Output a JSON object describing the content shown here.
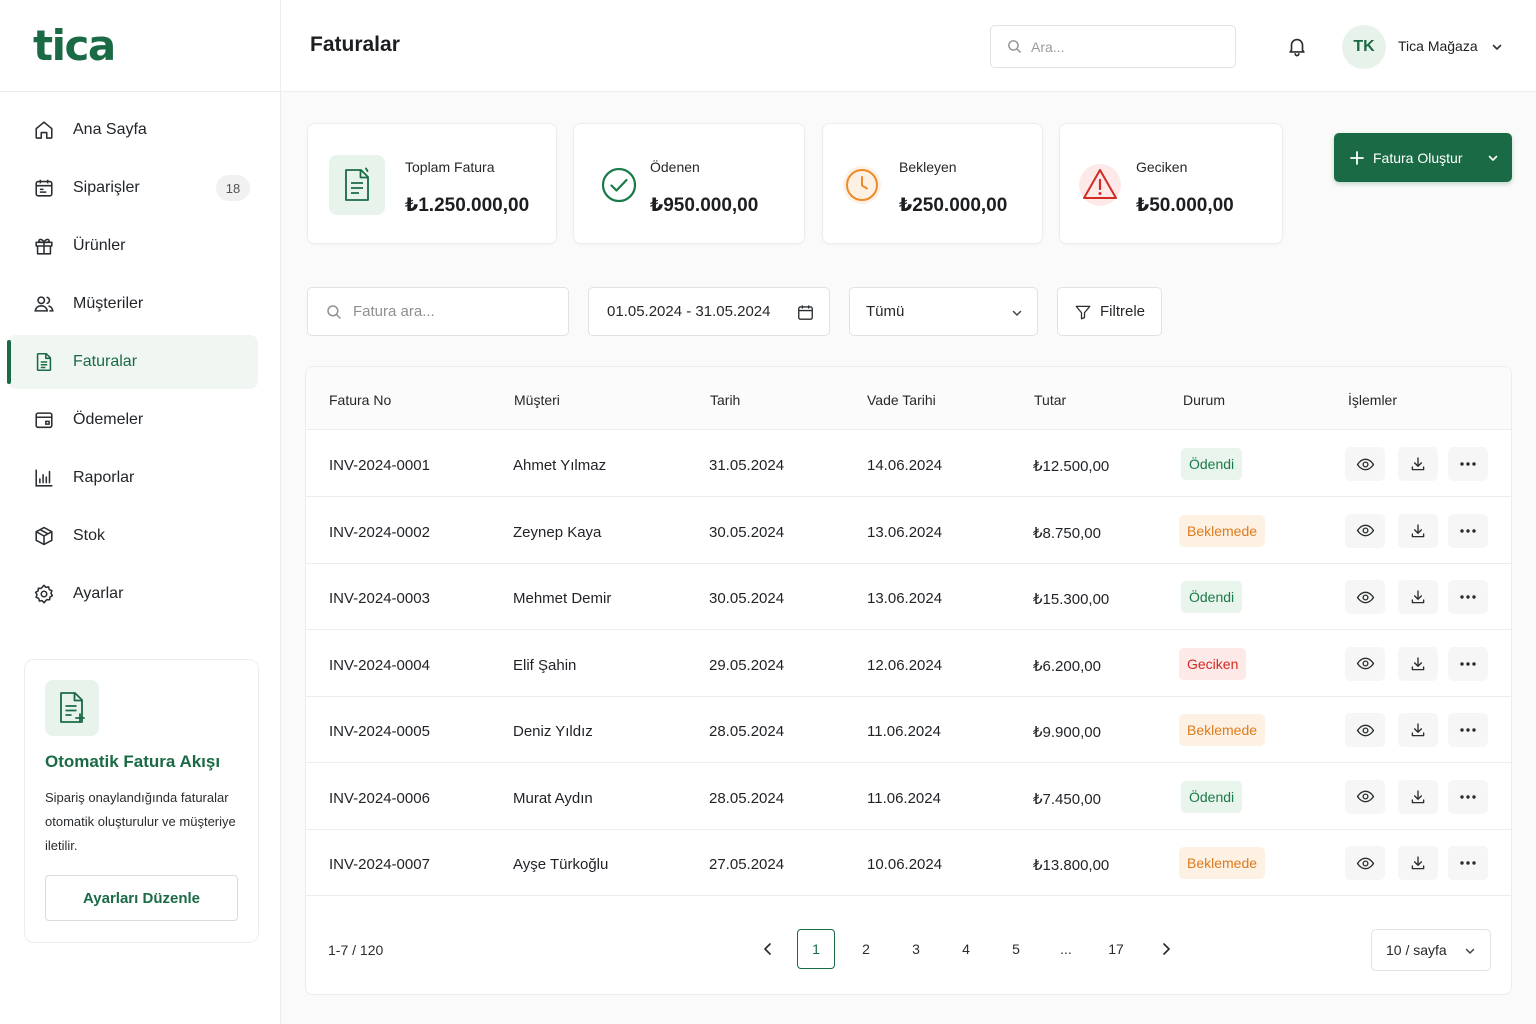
{
  "brand": {
    "logo": "tica",
    "accent": "#1a6b45"
  },
  "sidebar": {
    "items": [
      {
        "label": "Ana Sayfa",
        "icon": "home-icon"
      },
      {
        "label": "Siparişler",
        "icon": "orders-icon",
        "badge": "18"
      },
      {
        "label": "Ürünler",
        "icon": "gift-icon"
      },
      {
        "label": "Müşteriler",
        "icon": "users-icon"
      },
      {
        "label": "Faturalar",
        "icon": "document-icon",
        "active": true
      },
      {
        "label": "Ödemeler",
        "icon": "wallet-icon"
      },
      {
        "label": "Raporlar",
        "icon": "chart-icon"
      },
      {
        "label": "Stok",
        "icon": "box-icon"
      },
      {
        "label": "Ayarlar",
        "icon": "gear-icon"
      }
    ],
    "promo": {
      "title": "Otomatik Fatura Akışı",
      "text": "Sipariş onaylandığında faturalar otomatik oluşturulur ve müşteriye iletilir.",
      "button": "Ayarları Düzenle"
    }
  },
  "header": {
    "title": "Faturalar",
    "search_placeholder": "Ara...",
    "user_initials": "TK",
    "user_name": "Tica Mağaza"
  },
  "stats": [
    {
      "label": "Toplam Fatura",
      "value": "₺1.250.000,00",
      "icon": "invoice-icon"
    },
    {
      "label": "Ödenen",
      "value": "₺950.000,00",
      "icon": "check-circle-icon"
    },
    {
      "label": "Bekleyen",
      "value": "₺250.000,00",
      "icon": "clock-icon"
    },
    {
      "label": "Geciken",
      "value": "₺50.000,00",
      "icon": "warning-icon"
    }
  ],
  "create_button": "Fatura Oluştur",
  "filters": {
    "search_placeholder": "Fatura ara...",
    "date_range": "01.05.2024 - 31.05.2024",
    "status_select": "Tümü",
    "filter_button": "Filtrele"
  },
  "table": {
    "columns": [
      "Fatura No",
      "Müşteri",
      "Tarih",
      "Vade Tarihi",
      "Tutar",
      "Durum",
      "İşlemler"
    ],
    "rows": [
      {
        "no": "INV-2024-0001",
        "customer": "Ahmet Yılmaz",
        "date": "31.05.2024",
        "due": "14.06.2024",
        "amount": "₺12.500,00",
        "status": "Ödendi",
        "kind": "paid"
      },
      {
        "no": "INV-2024-0002",
        "customer": "Zeynep Kaya",
        "date": "30.05.2024",
        "due": "13.06.2024",
        "amount": "₺8.750,00",
        "status": "Beklemede",
        "kind": "pending"
      },
      {
        "no": "INV-2024-0003",
        "customer": "Mehmet Demir",
        "date": "30.05.2024",
        "due": "13.06.2024",
        "amount": "₺15.300,00",
        "status": "Ödendi",
        "kind": "paid"
      },
      {
        "no": "INV-2024-0004",
        "customer": "Elif Şahin",
        "date": "29.05.2024",
        "due": "12.06.2024",
        "amount": "₺6.200,00",
        "status": "Geciken",
        "kind": "late"
      },
      {
        "no": "INV-2024-0005",
        "customer": "Deniz Yıldız",
        "date": "28.05.2024",
        "due": "11.06.2024",
        "amount": "₺9.900,00",
        "status": "Beklemede",
        "kind": "pending"
      },
      {
        "no": "INV-2024-0006",
        "customer": "Murat Aydın",
        "date": "28.05.2024",
        "due": "11.06.2024",
        "amount": "₺7.450,00",
        "status": "Ödendi",
        "kind": "paid"
      },
      {
        "no": "INV-2024-0007",
        "customer": "Ayşe Türkoğlu",
        "date": "27.05.2024",
        "due": "10.06.2024",
        "amount": "₺13.800,00",
        "status": "Beklemede",
        "kind": "pending"
      }
    ]
  },
  "pagination": {
    "info": "1-7 / 120",
    "pages": [
      "1",
      "2",
      "3",
      "4",
      "5",
      "...",
      "17"
    ],
    "current": "1",
    "per_page": "10 / sayfa"
  }
}
